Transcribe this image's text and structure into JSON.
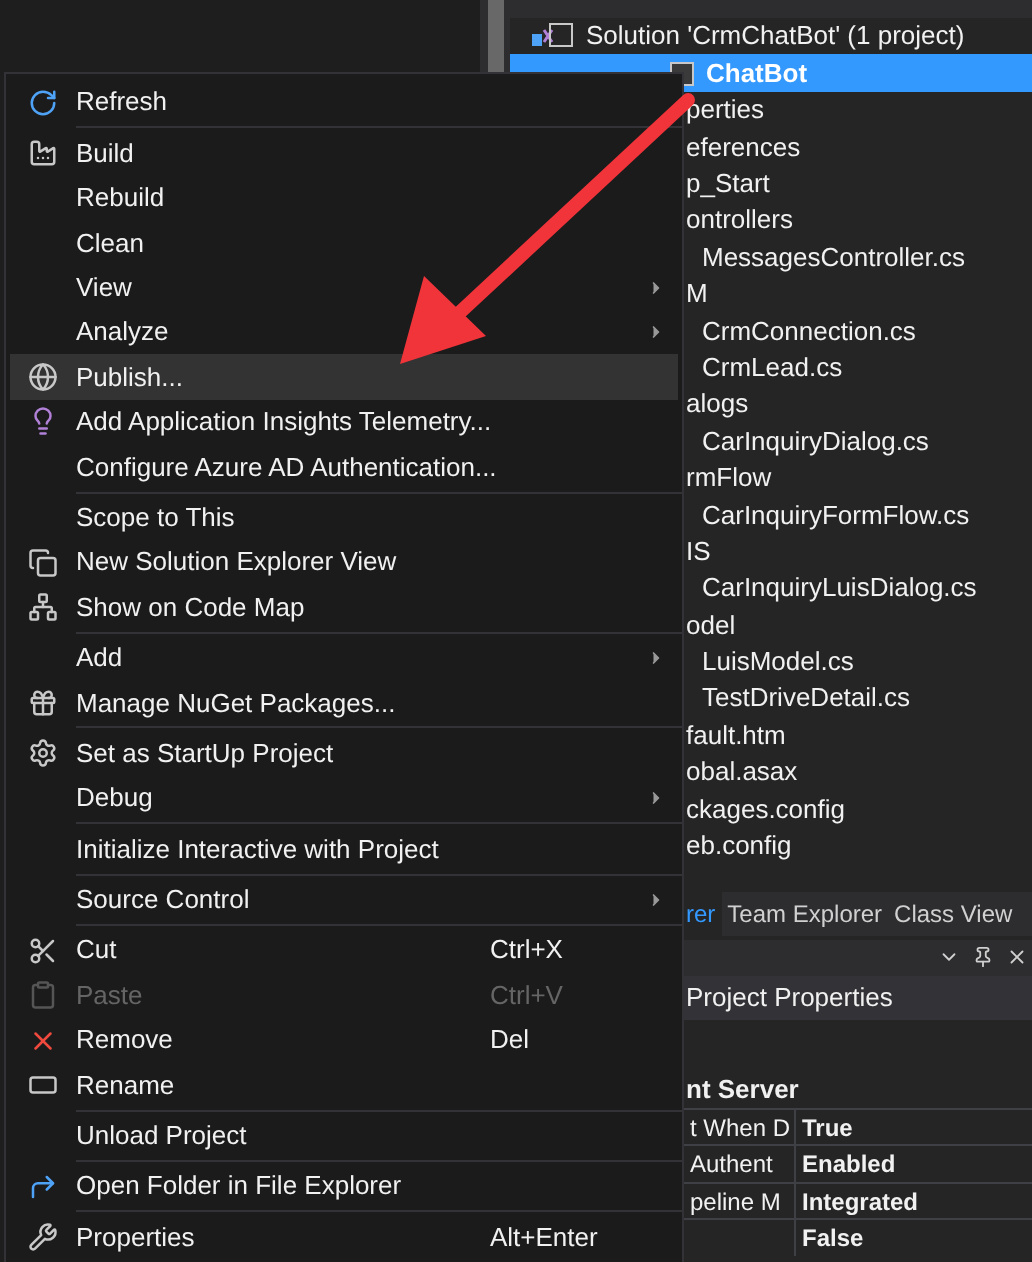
{
  "solution_explorer": {
    "tree": [
      {
        "label": "Solution 'CrmChatBot' (1 project)",
        "selected": false,
        "children": [
          {
            "label": "ChatBot",
            "selected": true,
            "children": [
              {
                "label": "perties",
                "selected": false
              },
              {
                "label": "eferences",
                "selected": false
              },
              {
                "label": "p_Start",
                "selected": false
              },
              {
                "label": "ontrollers",
                "selected": false,
                "children": [
                  {
                    "label": "MessagesController.cs",
                    "selected": false
                  }
                ]
              },
              {
                "label": "M",
                "selected": false,
                "children": [
                  {
                    "label": "CrmConnection.cs",
                    "selected": false
                  },
                  {
                    "label": "CrmLead.cs",
                    "selected": false
                  }
                ]
              },
              {
                "label": "alogs",
                "selected": false,
                "children": [
                  {
                    "label": "CarInquiryDialog.cs",
                    "selected": false
                  }
                ]
              },
              {
                "label": "rmFlow",
                "selected": false,
                "children": [
                  {
                    "label": "CarInquiryFormFlow.cs",
                    "selected": false
                  }
                ]
              },
              {
                "label": "IS",
                "selected": false,
                "children": [
                  {
                    "label": "CarInquiryLuisDialog.cs",
                    "selected": false
                  }
                ]
              },
              {
                "label": "odel",
                "selected": false,
                "children": [
                  {
                    "label": "LuisModel.cs",
                    "selected": false
                  },
                  {
                    "label": "TestDriveDetail.cs",
                    "selected": false
                  }
                ]
              },
              {
                "label": "fault.htm",
                "selected": false
              },
              {
                "label": "obal.asax",
                "selected": false
              },
              {
                "label": "ckages.config",
                "selected": false
              },
              {
                "label": "eb.config",
                "selected": false
              }
            ]
          }
        ]
      }
    ]
  },
  "tabs": [
    {
      "label": "rer",
      "selected": true
    },
    {
      "label": "Team Explorer",
      "selected": false
    },
    {
      "label": "Class View",
      "selected": false
    }
  ],
  "properties": {
    "object": "Project Properties",
    "category": "nt Server",
    "rows": [
      {
        "name": "t When D",
        "value": "True"
      },
      {
        "name": "Authent",
        "value": "Enabled"
      },
      {
        "name": "peline M",
        "value": "Integrated"
      },
      {
        "value": "False"
      }
    ]
  },
  "context_menu": [
    {
      "kind": "item",
      "label": "Refresh",
      "selected": false,
      "disabled": false,
      "submenu": false
    },
    {
      "kind": "separator"
    },
    {
      "kind": "item",
      "label": "Build",
      "selected": false,
      "disabled": false,
      "submenu": false
    },
    {
      "kind": "item",
      "label": "Rebuild",
      "selected": false,
      "disabled": false,
      "submenu": false
    },
    {
      "kind": "item",
      "label": "Clean",
      "selected": false,
      "disabled": false,
      "submenu": false
    },
    {
      "kind": "item",
      "label": "View",
      "selected": false,
      "disabled": false,
      "submenu": true
    },
    {
      "kind": "item",
      "label": "Analyze",
      "selected": false,
      "disabled": false,
      "submenu": true
    },
    {
      "kind": "item",
      "label": "Publish...",
      "selected": true,
      "disabled": false,
      "submenu": false
    },
    {
      "kind": "item",
      "label": "Add Application Insights Telemetry...",
      "selected": false,
      "disabled": false,
      "submenu": false
    },
    {
      "kind": "item",
      "label": "Configure Azure AD Authentication...",
      "selected": false,
      "disabled": false,
      "submenu": false
    },
    {
      "kind": "separator"
    },
    {
      "kind": "item",
      "label": "Scope to This",
      "selected": false,
      "disabled": false,
      "submenu": false
    },
    {
      "kind": "item",
      "label": "New Solution Explorer View",
      "selected": false,
      "disabled": false,
      "submenu": false
    },
    {
      "kind": "item",
      "label": "Show on Code Map",
      "selected": false,
      "disabled": false,
      "submenu": false
    },
    {
      "kind": "separator"
    },
    {
      "kind": "item",
      "label": "Add",
      "selected": false,
      "disabled": false,
      "submenu": true
    },
    {
      "kind": "item",
      "label": "Manage NuGet Packages...",
      "selected": false,
      "disabled": false,
      "submenu": false
    },
    {
      "kind": "separator"
    },
    {
      "kind": "item",
      "label": "Set as StartUp Project",
      "selected": false,
      "disabled": false,
      "submenu": false
    },
    {
      "kind": "item",
      "label": "Debug",
      "selected": false,
      "disabled": false,
      "submenu": true
    },
    {
      "kind": "separator"
    },
    {
      "kind": "item",
      "label": "Initialize Interactive with Project",
      "selected": false,
      "disabled": false,
      "submenu": false
    },
    {
      "kind": "separator"
    },
    {
      "kind": "item",
      "label": "Source Control",
      "selected": false,
      "disabled": false,
      "submenu": true
    },
    {
      "kind": "separator"
    },
    {
      "kind": "item",
      "label": "Cut",
      "shortcut": "Ctrl+X",
      "selected": false,
      "disabled": false,
      "submenu": false
    },
    {
      "kind": "item",
      "label": "Paste",
      "shortcut": "Ctrl+V",
      "selected": false,
      "disabled": true,
      "submenu": false
    },
    {
      "kind": "item",
      "label": "Remove",
      "shortcut": "Del",
      "selected": false,
      "disabled": false,
      "submenu": false
    },
    {
      "kind": "item",
      "label": "Rename",
      "selected": false,
      "disabled": false,
      "submenu": false
    },
    {
      "kind": "separator"
    },
    {
      "kind": "item",
      "label": "Unload Project",
      "selected": false,
      "disabled": false,
      "submenu": false
    },
    {
      "kind": "separator"
    },
    {
      "kind": "item",
      "label": "Open Folder in File Explorer",
      "selected": false,
      "disabled": false,
      "submenu": false
    },
    {
      "kind": "separator"
    },
    {
      "kind": "item",
      "label": "Properties",
      "shortcut": "Alt+Enter",
      "selected": false,
      "disabled": false,
      "submenu": false
    }
  ]
}
